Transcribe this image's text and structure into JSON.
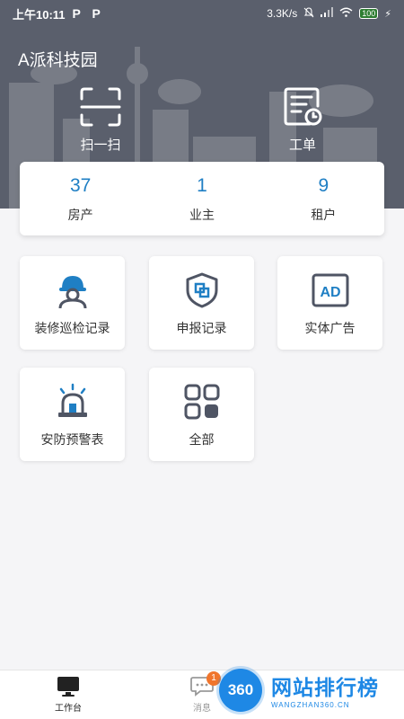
{
  "status_bar": {
    "time": "上午10:11",
    "notification_icons": [
      "P",
      "P"
    ],
    "network_speed": "3.3K/s",
    "battery": "100"
  },
  "header": {
    "title": "A派科技园",
    "quick_actions": [
      {
        "label": "扫一扫",
        "icon": "scan-icon"
      },
      {
        "label": "工单",
        "icon": "work-order-icon"
      }
    ]
  },
  "stats": [
    {
      "value": "37",
      "label": "房产"
    },
    {
      "value": "1",
      "label": "业主"
    },
    {
      "value": "9",
      "label": "租户"
    }
  ],
  "tiles": [
    {
      "label": "装修巡检记录",
      "icon": "worker-helmet-icon"
    },
    {
      "label": "申报记录",
      "icon": "shield-report-icon"
    },
    {
      "label": "实体广告",
      "icon": "ad-icon",
      "icon_text": "AD"
    },
    {
      "label": "安防预警表",
      "icon": "alarm-siren-icon"
    },
    {
      "label": "全部",
      "icon": "all-grid-icon"
    }
  ],
  "tab_bar": {
    "items": [
      {
        "label": "工作台",
        "icon": "monitor-icon",
        "active": true
      },
      {
        "label": "消息",
        "icon": "message-icon",
        "badge": "1",
        "active": false
      }
    ]
  },
  "watermark": {
    "logo_text": "360",
    "text": "网站排行榜",
    "subtext": "WANGZHAN360.CN"
  },
  "colors": {
    "header_bg": "#5a5f6c",
    "accent_blue": "#1f7fc4",
    "icon_dark": "#4f5564",
    "badge_orange": "#f0752c"
  }
}
